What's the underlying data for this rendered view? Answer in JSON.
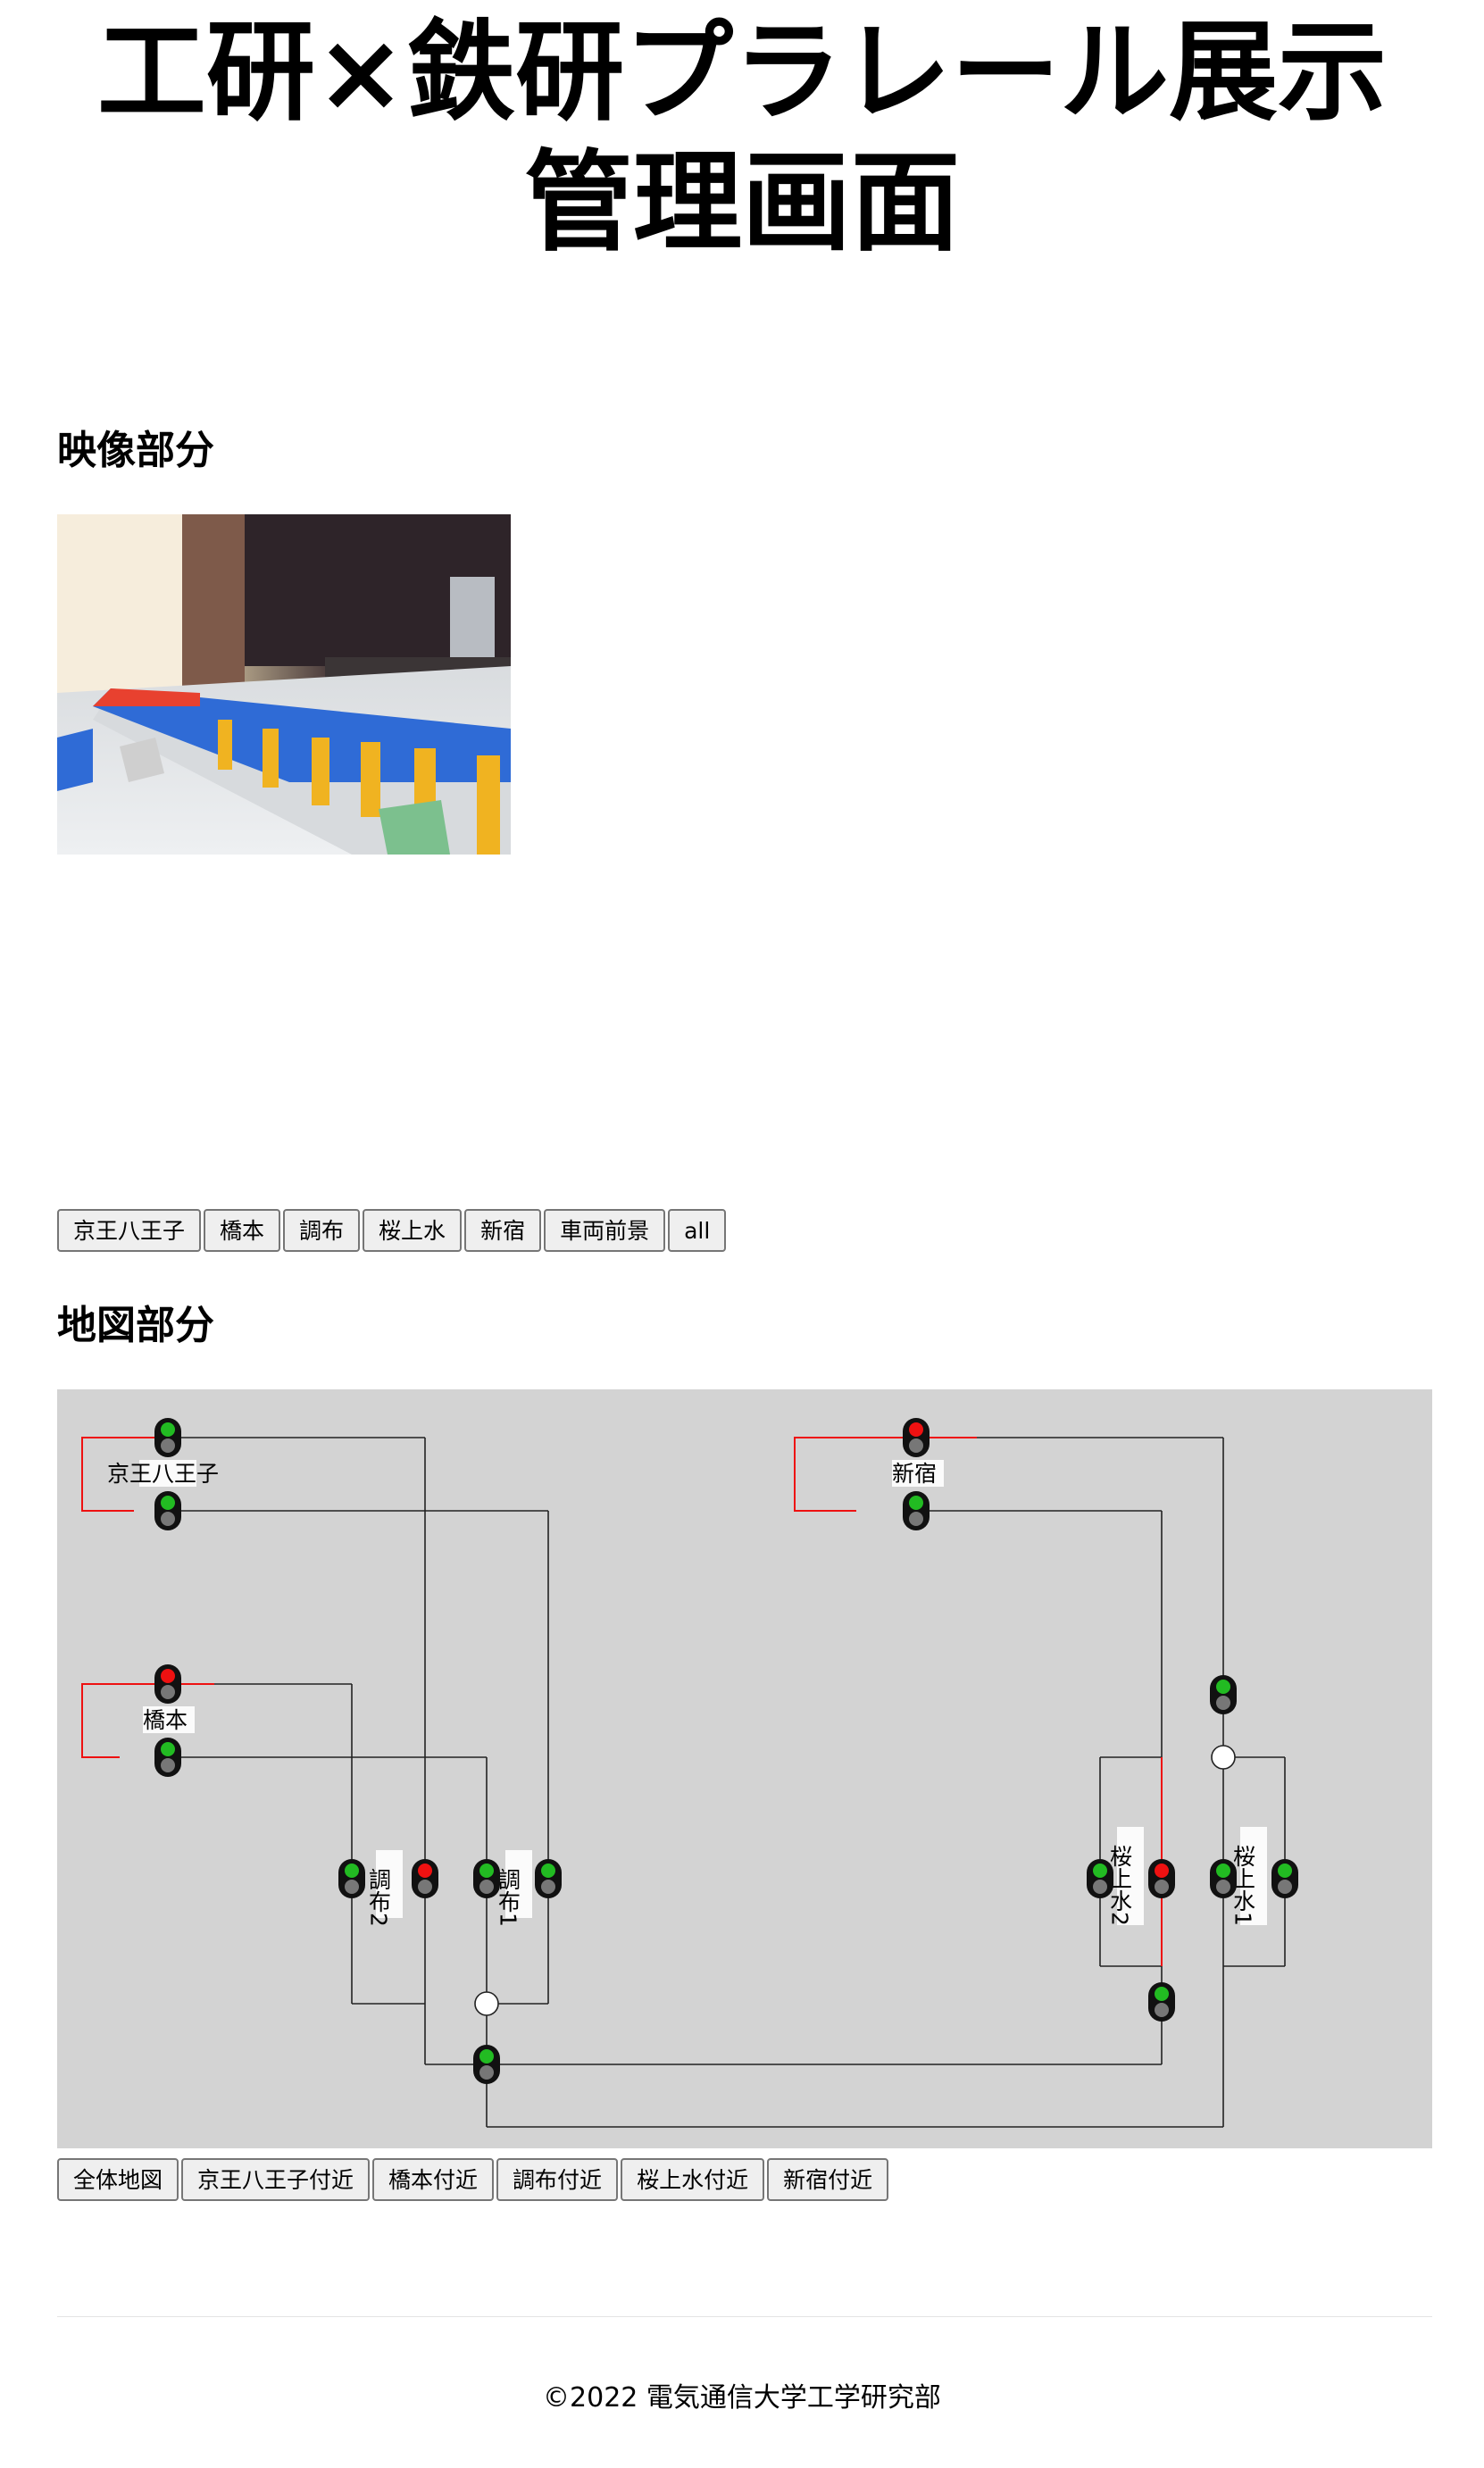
{
  "page": {
    "title_line1": "工研×鉄研プラレール展示",
    "title_line2": "管理画面"
  },
  "video": {
    "heading": "映像部分",
    "camera_buttons": [
      "京王八王子",
      "橋本",
      "調布",
      "桜上水",
      "新宿",
      "車両前景",
      "all"
    ]
  },
  "map": {
    "heading": "地図部分",
    "stations": {
      "keio_hachioji": "京王八王子",
      "hashimoto": "橋本",
      "shinjuku": "新宿",
      "chofu2": "調布2",
      "chofu1": "調布1",
      "sakurajosui2": "桜上水2",
      "sakurajosui1": "桜上水1"
    },
    "signal_colors": {
      "green": "#22bb22",
      "red": "#ee1111",
      "off": "#777777"
    },
    "signals": {
      "kh_upper": "green",
      "kh_lower": "green",
      "hashimoto_upper": "red",
      "hashimoto_lower": "green",
      "shinjuku_upper": "red",
      "shinjuku_lower": "green",
      "chofu2_left": "green",
      "chofu2_right": "red",
      "chofu1_left": "green",
      "chofu1_right": "green",
      "sj1_top": "green",
      "sj2_left": "green",
      "sj2_right": "red",
      "sj1_left": "green",
      "sj1_right": "green",
      "sj2_bottom": "green",
      "junction_mid": "green"
    },
    "area_buttons": [
      "全体地図",
      "京王八王子付近",
      "橋本付近",
      "調布付近",
      "桜上水付近",
      "新宿付近"
    ]
  },
  "footer": {
    "copyright": "©2022 電気通信大学工学研究部"
  }
}
